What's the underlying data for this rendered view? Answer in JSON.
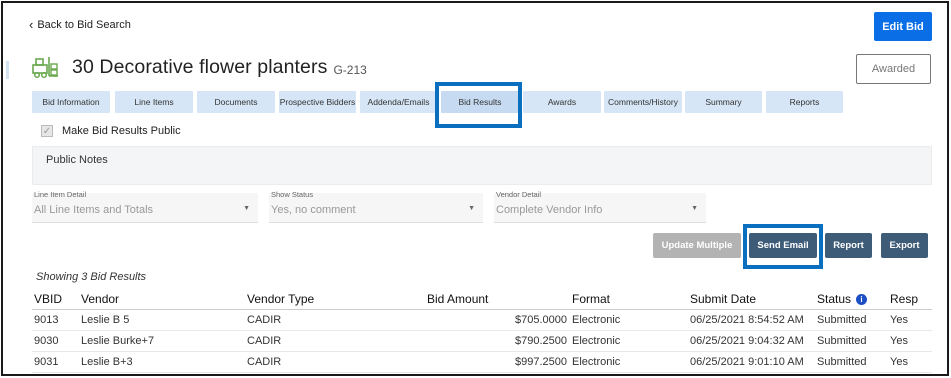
{
  "nav": {
    "back_label": "Back to Bid Search",
    "edit_bid_label": "Edit Bid"
  },
  "bid": {
    "title": "30 Decorative flower planters",
    "code": "G-213",
    "status_badge": "Awarded"
  },
  "tabs": [
    {
      "label": "Bid Information"
    },
    {
      "label": "Line Items"
    },
    {
      "label": "Documents"
    },
    {
      "label": "Prospective Bidders"
    },
    {
      "label": "Addenda/Emails"
    },
    {
      "label": "Bid Results",
      "active": true
    },
    {
      "label": "Awards"
    },
    {
      "label": "Comments/History"
    },
    {
      "label": "Summary"
    },
    {
      "label": "Reports"
    }
  ],
  "public_results": {
    "label": "Make Bid Results Public",
    "checked": true
  },
  "notes": {
    "label": "Public Notes"
  },
  "filters": {
    "line_item": {
      "label": "Line Item Detail",
      "value": "All Line Items and Totals"
    },
    "status": {
      "label": "Show Status",
      "value": "Yes, no comment"
    },
    "vendor": {
      "label": "Vendor Detail",
      "value": "Complete Vendor Info"
    }
  },
  "actions": {
    "update_multiple": "Update Multiple",
    "send_email": "Send Email",
    "report": "Report",
    "export": "Export"
  },
  "results": {
    "showing_text": "Showing 3 Bid Results",
    "columns": [
      "VBID",
      "Vendor",
      "Vendor Type",
      "Bid Amount",
      "Format",
      "Submit Date",
      "Status",
      "Resp"
    ],
    "rows": [
      [
        "9013",
        "Leslie B 5",
        "CADIR",
        "$705.0000",
        "Electronic",
        "06/25/2021 8:54:52 AM",
        "Submitted",
        "Yes"
      ],
      [
        "9030",
        "Leslie Burke+7",
        "CADIR",
        "$790.2500",
        "Electronic",
        "06/25/2021 9:04:32 AM",
        "Submitted",
        "Yes"
      ],
      [
        "9031",
        "Leslie B+3",
        "CADIR",
        "$997.2500",
        "Electronic",
        "06/25/2021 9:01:10 AM",
        "Submitted",
        "Yes"
      ]
    ]
  },
  "colors": {
    "primary": "#0a6fe6",
    "tab_bg": "#d6e6f7",
    "action_btn": "#3e5c78",
    "highlight": "#0a6fbf"
  }
}
